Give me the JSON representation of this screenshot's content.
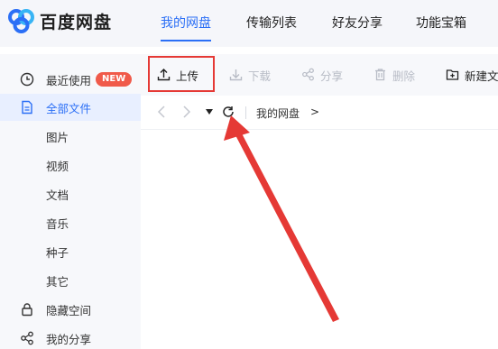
{
  "app": {
    "brand": "百度网盘"
  },
  "nav": {
    "tabs": [
      {
        "label": "我的网盘",
        "active": true
      },
      {
        "label": "传输列表",
        "active": false
      },
      {
        "label": "好友分享",
        "active": false
      },
      {
        "label": "功能宝箱",
        "active": false
      }
    ]
  },
  "sidebar": {
    "items": [
      {
        "label": "最近使用",
        "icon": "clock-icon",
        "badge": "NEW"
      },
      {
        "label": "全部文件",
        "icon": "file-icon",
        "active": true
      },
      {
        "label": "图片"
      },
      {
        "label": "视频"
      },
      {
        "label": "文档"
      },
      {
        "label": "音乐"
      },
      {
        "label": "种子"
      },
      {
        "label": "其它"
      },
      {
        "label": "隐藏空间",
        "icon": "lock-icon"
      },
      {
        "label": "我的分享",
        "icon": "share-icon"
      }
    ]
  },
  "toolbar": {
    "upload": "上传",
    "download": "下载",
    "share": "分享",
    "delete": "删除",
    "new_folder": "新建文"
  },
  "breadcrumb": {
    "path": "我的网盘",
    "separator": ">"
  },
  "colors": {
    "accent": "#2b6ff6",
    "highlight_box": "#e53935",
    "badge": "#f05a4a"
  }
}
